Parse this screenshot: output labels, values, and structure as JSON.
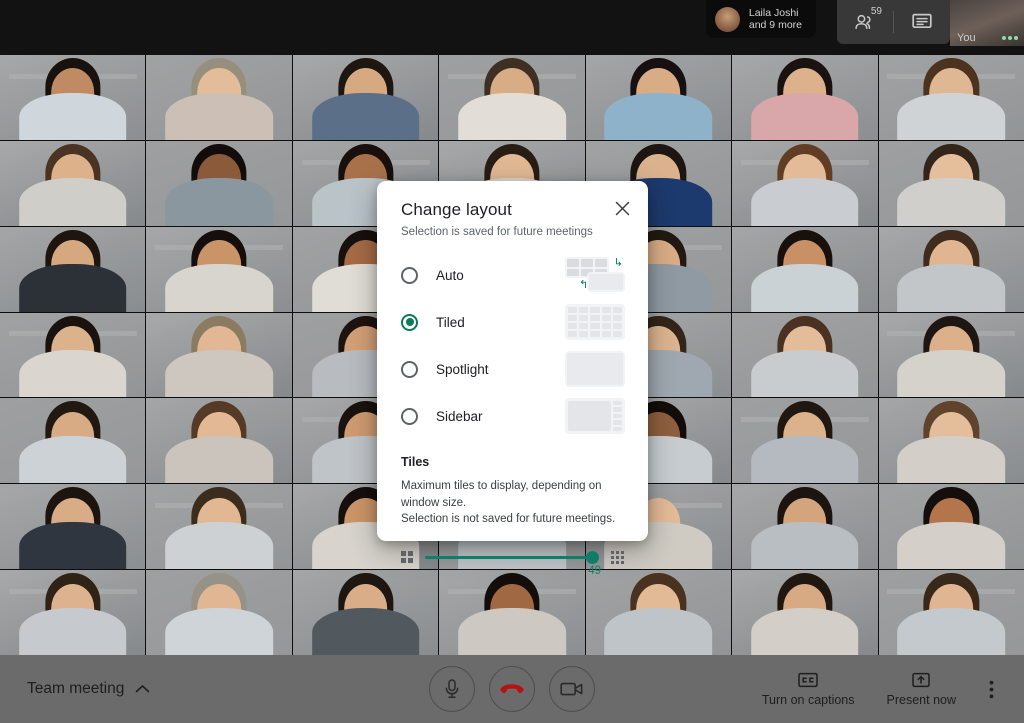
{
  "top_bar": {
    "presenter": {
      "name": "Laila Joshi",
      "subtitle": "and 9 more",
      "avatar_icon": "avatar"
    },
    "people_icon": "people-icon",
    "people_count": "59",
    "chat_icon": "chat-icon",
    "self_view": {
      "label": "You",
      "activity_icon": "audio-dots-icon"
    }
  },
  "dialog": {
    "title": "Change layout",
    "subtitle": "Selection is saved for future meetings",
    "close_icon": "close-icon",
    "accent_color": "#0b7a60",
    "options": [
      {
        "label": "Auto",
        "selected": false,
        "preview": "auto-preview"
      },
      {
        "label": "Tiled",
        "selected": true,
        "preview": "tiled-preview"
      },
      {
        "label": "Spotlight",
        "selected": false,
        "preview": "spotlight-preview"
      },
      {
        "label": "Sidebar",
        "selected": false,
        "preview": "sidebar-preview"
      }
    ],
    "tiles": {
      "heading": "Tiles",
      "description_line1": "Maximum tiles to display, depending on window size.",
      "description_line2": "Selection is not saved for future meetings.",
      "min_icon": "grid-small-icon",
      "max_icon": "grid-large-icon",
      "value": "49"
    }
  },
  "bottom_bar": {
    "meeting_name": "Team meeting",
    "meeting_chevron_icon": "chevron-up-icon",
    "mic_icon": "microphone-icon",
    "hangup_icon": "end-call-icon",
    "camera_icon": "camera-icon",
    "hangup_color": "#b31412",
    "captions_label": "Turn on captions",
    "captions_icon": "closed-captions-icon",
    "present_label": "Present now",
    "present_icon": "present-screen-icon",
    "more_icon": "more-vertical-icon"
  },
  "video_grid": {
    "columns": 7,
    "rows": 7,
    "tiles": [
      {
        "skin": "#c08a63",
        "hair": "#231a16",
        "top": "#cfd6dc",
        "room": "bright-kitchen"
      },
      {
        "skin": "#e3bd9a",
        "hair": "#d9cdb4",
        "top": "#cbbfb6",
        "room": "bright-room"
      },
      {
        "skin": "#d7a981",
        "hair": "#2b2018",
        "top": "#5b6f88",
        "room": "office-shelf"
      },
      {
        "skin": "#d8ac85",
        "hair": "#5a4433",
        "top": "#e2ded7",
        "room": "plain-wall"
      },
      {
        "skin": "#d9ac86",
        "hair": "#20181a",
        "top": "#8fb2cb",
        "room": "bookshelf"
      },
      {
        "skin": "#dcb18c",
        "hair": "#241a17",
        "top": "#d9a7aa",
        "room": "living-room"
      },
      {
        "skin": "#e0b793",
        "hair": "#6d4a2f",
        "top": "#cfd3d6",
        "room": "white-room"
      },
      {
        "skin": "#ddb18a",
        "hair": "#6b4a32",
        "top": "#cfcec9",
        "room": "striped-shirt"
      },
      {
        "skin": "#8a5a3b",
        "hair": "#1a1310",
        "top": "#8a979e",
        "room": "home-office"
      },
      {
        "skin": "#a8714a",
        "hair": "#241713",
        "top": "#b9c3c8",
        "room": "bright-wall"
      },
      {
        "skin": "#e2b894",
        "hair": "#3a2a1f",
        "top": "#dedad3",
        "room": "neutral-room"
      },
      {
        "skin": "#dbb28d",
        "hair": "#2a1f19",
        "top": "#1d3a6e",
        "room": "blue-pattern"
      },
      {
        "skin": "#e3bb98",
        "hair": "#8c5a33",
        "top": "#c9ccd0",
        "room": "window-light"
      },
      {
        "skin": "#e5bf9c",
        "hair": "#4b3526",
        "top": "#d0cfcb",
        "room": "plain-room"
      },
      {
        "skin": "#d6a87f",
        "hair": "#2c1f18",
        "top": "#2c3138",
        "room": "bright-office"
      },
      {
        "skin": "#c99468",
        "hair": "#1f1512",
        "top": "#d8d5cf",
        "room": "kitchen"
      },
      {
        "skin": "#a66b45",
        "hair": "#221713",
        "top": "#e0ddd6",
        "room": "home"
      },
      {
        "skin": "#dab089",
        "hair": "#2d2018",
        "top": "#b9bdc2",
        "room": "bookshelf-2"
      },
      {
        "skin": "#d9ad87",
        "hair": "#33241b",
        "top": "#8f9aa3",
        "room": "gray-room"
      },
      {
        "skin": "#c89064",
        "hair": "#221814",
        "top": "#cbd2d6",
        "room": "window"
      },
      {
        "skin": "#e0b591",
        "hair": "#5c3f2a",
        "top": "#c2c6c9",
        "room": "light-wall"
      },
      {
        "skin": "#dcb28d",
        "hair": "#241b16",
        "top": "#dad6cf",
        "room": "plain-2"
      },
      {
        "skin": "#e1b795",
        "hair": "#c8b08a",
        "top": "#cdc7bf",
        "room": "bright-3"
      },
      {
        "skin": "#d3a077",
        "hair": "#2a1d16",
        "top": "#b8bcc0",
        "room": "room-4"
      },
      {
        "skin": "#b87b50",
        "hair": "#1e1512",
        "top": "#d2cec7",
        "room": "room-5"
      },
      {
        "skin": "#dcb48f",
        "hair": "#4a3524",
        "top": "#9fa8b0",
        "room": "room-6"
      },
      {
        "skin": "#e3bc99",
        "hair": "#6b4730",
        "top": "#c9ccce",
        "room": "room-7"
      },
      {
        "skin": "#dbb08a",
        "hair": "#2b201a",
        "top": "#d5d2cb",
        "room": "room-8"
      },
      {
        "skin": "#d9ab84",
        "hair": "#30231a",
        "top": "#cdd2d6",
        "room": "room-9"
      },
      {
        "skin": "#e2b994",
        "hair": "#7a5437",
        "top": "#cac4bc",
        "room": "room-10"
      },
      {
        "skin": "#cf9b71",
        "hair": "#241a15",
        "top": "#bfc4c8",
        "room": "room-11"
      },
      {
        "skin": "#e0b693",
        "hair": "#4e372552",
        "top": "#d6d3cc",
        "room": "room-12"
      },
      {
        "skin": "#8f5f3e",
        "hair": "#1b1411",
        "top": "#c7ccd0",
        "room": "room-13"
      },
      {
        "skin": "#dcb28c",
        "hair": "#2e2119",
        "top": "#b5bac0",
        "room": "room-14"
      },
      {
        "skin": "#e4bd9a",
        "hair": "#8a6040",
        "top": "#d3cfc8",
        "room": "room-15"
      },
      {
        "skin": "#d8ac86",
        "hair": "#2a1e17",
        "top": "#2f3640",
        "room": "room-16"
      },
      {
        "skin": "#e1b892",
        "hair": "#574029",
        "top": "#cdd1d4",
        "room": "room-17"
      },
      {
        "skin": "#cc9568",
        "hair": "#1f1713",
        "top": "#d8d4cd",
        "room": "room-18"
      },
      {
        "skin": "#dfb58f",
        "hair": "#3b2b20",
        "top": "#c0c5c9",
        "room": "room-19"
      },
      {
        "skin": "#e3bb97",
        "hair": "#a0apple",
        "top": "#cfcbc3",
        "room": "room-20"
      },
      {
        "skin": "#d4a47c",
        "hair": "#281d17",
        "top": "#b9bec3",
        "room": "room-21"
      },
      {
        "skin": "#b3764c",
        "hair": "#1d1512",
        "top": "#d4d0c9",
        "room": "room-22"
      },
      {
        "skin": "#dcb38e",
        "hair": "#45311f",
        "top": "#c6cace",
        "room": "room-23"
      },
      {
        "skin": "#e0b792",
        "hair": "#d8d2c2",
        "top": "#cfd4d8",
        "room": "room-24"
      },
      {
        "skin": "#d9ad88",
        "hair": "#2c2018",
        "top": "#51595f",
        "room": "room-25"
      },
      {
        "skin": "#a16844",
        "hair": "#1c1411",
        "top": "#cdc9c2",
        "room": "room-26"
      },
      {
        "skin": "#e2ba96",
        "hair": "#6a4830",
        "top": "#bfc4c8",
        "room": "room-27"
      },
      {
        "skin": "#d7aa83",
        "hair": "#2f2219",
        "top": "#d3cfc8",
        "room": "room-28"
      },
      {
        "skin": "#dfb691",
        "hair": "#523a26",
        "top": "#c4c9cd",
        "room": "room-29"
      }
    ]
  }
}
